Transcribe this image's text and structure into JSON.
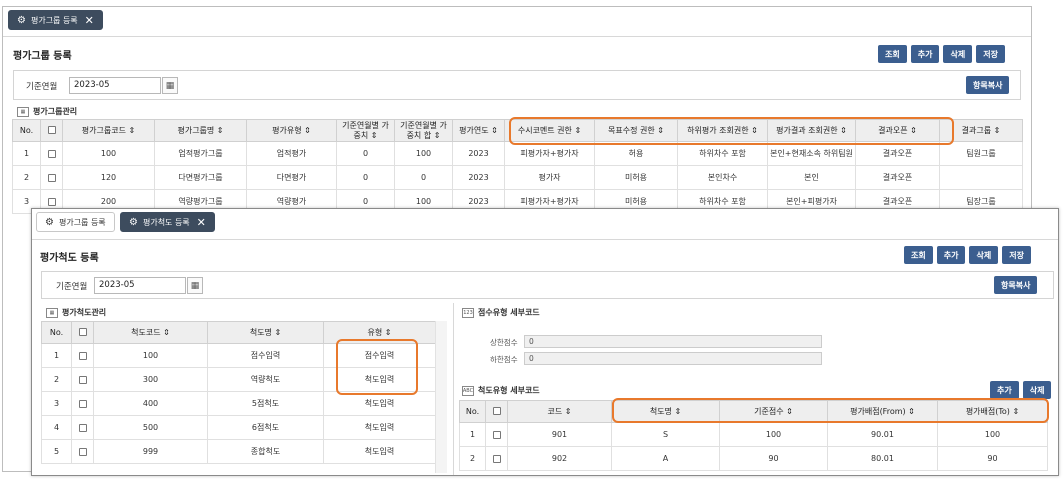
{
  "back": {
    "tab": {
      "label": "평가그룹 등록",
      "icon": "sliders-icon",
      "close": "✕"
    },
    "title": "평가그룹 등록",
    "buttons": [
      "조회",
      "추가",
      "삭제",
      "저장"
    ],
    "filter": {
      "label": "기준연월",
      "value": "2023-05"
    },
    "copy_button": "항목복사",
    "section_label": "평가그룹관리",
    "table": {
      "headers": [
        "No.",
        "",
        "평가그룹코드 ⇕",
        "평가그룹명 ⇕",
        "평가유형 ⇕",
        "기준연월별 가중치 ⇕",
        "기준연월별 가중치 합 ⇕",
        "평가연도 ⇕",
        "수시코멘트 권한 ⇕",
        "목표수정 권한 ⇕",
        "하위평가 조회권한 ⇕",
        "평가결과 조회권한 ⇕",
        "결과오픈 ⇕",
        "결과그룹 ⇕"
      ],
      "rows": [
        [
          "1",
          "",
          "100",
          "업적평가그룹",
          "업적평가",
          "0",
          "100",
          "2023",
          "피평가자+평가자",
          "허용",
          "하위차수 포함",
          "본인+현재소속 하위팀원",
          "결과오픈",
          "팀원그룹"
        ],
        [
          "2",
          "",
          "120",
          "다면평가그룹",
          "다면평가",
          "0",
          "0",
          "2023",
          "평가자",
          "미허용",
          "본인차수",
          "본인",
          "결과오픈",
          ""
        ],
        [
          "3",
          "",
          "200",
          "역량평가그룹",
          "역량평가",
          "0",
          "100",
          "2023",
          "피평가자+평가자",
          "미허용",
          "하위차수 포함",
          "본인+피평가자",
          "결과오픈",
          "팀장그룹"
        ]
      ]
    }
  },
  "front": {
    "tabs": [
      {
        "label": "평가그룹 등록",
        "icon": "sliders-icon"
      },
      {
        "label": "평가척도 등록",
        "icon": "sliders-icon",
        "close": "✕"
      }
    ],
    "title": "평가척도 등록",
    "buttons": [
      "조회",
      "추가",
      "삭제",
      "저장"
    ],
    "filter": {
      "label": "기준연월",
      "value": "2023-05"
    },
    "copy_button": "항목복사",
    "left": {
      "section_label": "평가척도관리",
      "headers": [
        "No.",
        "",
        "척도코드 ⇕",
        "척도명 ⇕",
        "유형 ⇕"
      ],
      "rows": [
        [
          "1",
          "",
          "100",
          "점수입력",
          "점수입력"
        ],
        [
          "2",
          "",
          "300",
          "역량척도",
          "척도입력"
        ],
        [
          "3",
          "",
          "400",
          "5점척도",
          "척도입력"
        ],
        [
          "4",
          "",
          "500",
          "6점척도",
          "척도입력"
        ],
        [
          "5",
          "",
          "999",
          "종합척도",
          "척도입력"
        ]
      ]
    },
    "score": {
      "section_label": "점수유형 세부코드",
      "section_icon": "123",
      "upper_label": "상한점수",
      "upper_value": "0",
      "lower_label": "하한점수",
      "lower_value": "0"
    },
    "scale": {
      "section_label": "척도유형 세부코드",
      "section_icon": "ABC",
      "buttons": [
        "추가",
        "삭제"
      ],
      "headers": [
        "No.",
        "",
        "코드 ⇕",
        "척도명 ⇕",
        "기준점수 ⇕",
        "평가배점(From) ⇕",
        "평가배점(To) ⇕"
      ],
      "rows": [
        [
          "1",
          "",
          "901",
          "S",
          "100",
          "90.01",
          "100"
        ],
        [
          "2",
          "",
          "902",
          "A",
          "90",
          "80.01",
          "90"
        ]
      ]
    }
  },
  "colors": {
    "accent_button": "#3b5e8f",
    "active_tab": "#3d4c5e",
    "highlight": "#e8792c"
  }
}
